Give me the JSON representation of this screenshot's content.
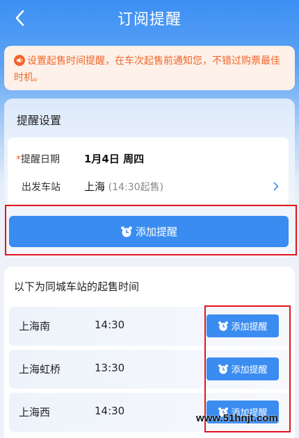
{
  "header": {
    "title": "订阅提醒"
  },
  "notice": {
    "icon": "megaphone-icon",
    "text": "设置起售时间提醒，在车次起售前通知您，不错过购票最佳时机。"
  },
  "settings": {
    "heading": "提醒设置",
    "date_label_star": "*",
    "date_label": "提醒日期",
    "date_value": "1月4日 周四",
    "station_label": "出发车站",
    "station_value": "上海",
    "station_sub": "(14:30起售)",
    "add_button_label": "添加提醒"
  },
  "stations": {
    "heading": "以下为同城车站的起售时间",
    "rows": [
      {
        "name": "上海南",
        "time": "14:30",
        "button_label": "添加提醒"
      },
      {
        "name": "上海虹桥",
        "time": "13:30",
        "button_label": "添加提醒"
      },
      {
        "name": "上海西",
        "time": "14:30",
        "button_label": "添加提醒"
      }
    ]
  },
  "watermark": "www.51hnjt.com",
  "colors": {
    "primary": "#3a8cf0",
    "notice_text": "#f0662a",
    "highlight_box": "#e3141b"
  }
}
